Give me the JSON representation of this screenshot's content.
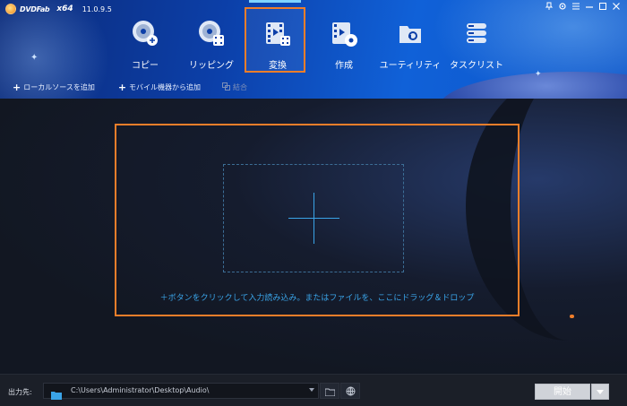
{
  "app": {
    "brand": "DVDFab",
    "arch": "x64",
    "version": "11.0.9.5"
  },
  "window_controls": [
    "pin-icon",
    "gear-icon",
    "menu-icon",
    "minimize-icon",
    "maximize-icon",
    "close-icon"
  ],
  "modes": [
    {
      "label": "コピー",
      "icon": "disc-copy-icon",
      "active": false
    },
    {
      "label": "リッピング",
      "icon": "disc-rip-icon",
      "active": false
    },
    {
      "label": "変換",
      "icon": "film-convert-icon",
      "active": true
    },
    {
      "label": "作成",
      "icon": "film-disc-create-icon",
      "active": false
    },
    {
      "label": "ユーティリティ",
      "icon": "toolbox-icon",
      "active": false
    },
    {
      "label": "タスクリスト",
      "icon": "task-list-icon",
      "active": false
    }
  ],
  "toolbar": {
    "add_local": "ローカルソースを追加",
    "add_mobile": "モバイル機器から追加",
    "merge": "結合"
  },
  "main": {
    "hint": "＋ボタンをクリックして入力読み込み。またはファイルを、ここにドラッグ＆ドロップ"
  },
  "footer": {
    "output_label": "出力先:",
    "output_path": "C:\\Users\\Administrator\\Desktop\\Audio\\",
    "start_label": "開始"
  },
  "colors": {
    "accent_orange": "#f07e2a",
    "hint_blue": "#3aa4e8",
    "header_blue": "#0c3fa8"
  }
}
